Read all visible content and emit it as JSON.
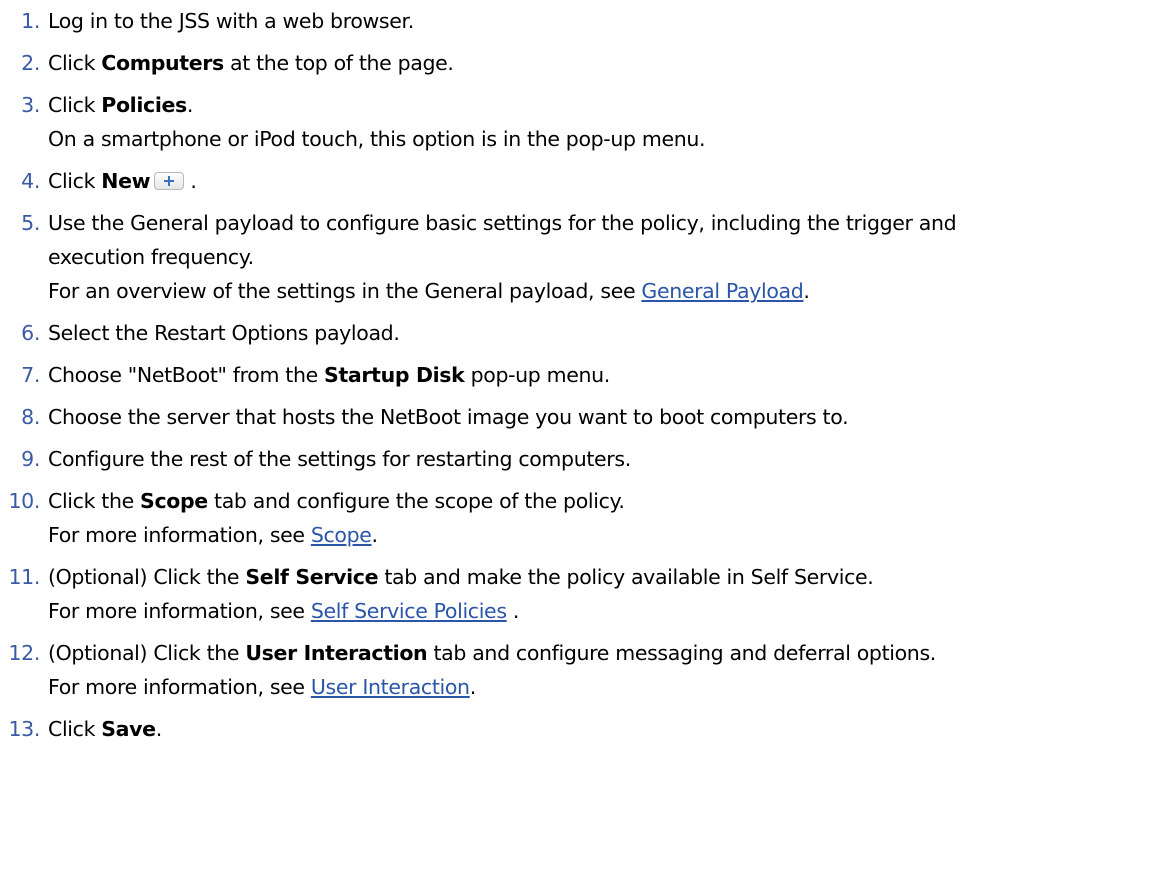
{
  "steps": [
    {
      "num": "1.",
      "a": "Log in to the JSS with a web browser."
    },
    {
      "num": "2.",
      "a": "Click ",
      "b": "Computers",
      "c": " at the top of the page."
    },
    {
      "num": "3.",
      "a": "Click ",
      "b": "Policies",
      "c": ".",
      "note": "On a smartphone or iPod touch, this option is in the pop-up menu."
    },
    {
      "num": "4.",
      "a": "Click ",
      "b": "New",
      "c": " ."
    },
    {
      "num": "5.",
      "a": "Use the General payload to configure basic settings for the policy, including the trigger and",
      "a2": "execution frequency.",
      "note": "For an overview of the settings in the General payload, see ",
      "link": "General Payload",
      "after": "."
    },
    {
      "num": "6.",
      "a": "Select the Restart Options payload."
    },
    {
      "num": "7.",
      "a": "Choose \"NetBoot\" from the ",
      "b": "Startup Disk",
      "c": " pop-up menu."
    },
    {
      "num": "8.",
      "a": "Choose the server that hosts the NetBoot image you want to boot computers to."
    },
    {
      "num": "9.",
      "a": "Configure the rest of the settings for restarting computers."
    },
    {
      "num": "10.",
      "a": "Click the ",
      "b": "Scope",
      "c": " tab and configure the scope of the policy.",
      "note": "For more information, see ",
      "link": "Scope",
      "after": "."
    },
    {
      "num": "11.",
      "a": "(Optional) Click the ",
      "b": "Self Service",
      "c": " tab and make the policy available in Self Service.",
      "note": "For more information, see ",
      "link": "Self Service Policies",
      "after": " ."
    },
    {
      "num": "12.",
      "a": "(Optional) Click the ",
      "b": "User Interaction",
      "c": " tab and configure messaging and deferral options.",
      "note": "For more information, see ",
      "link": "User Interaction",
      "after": "."
    },
    {
      "num": "13.",
      "a": "Click ",
      "b": "Save",
      "c": "."
    }
  ],
  "icons": {
    "new_button_icon": "plus-icon",
    "accent_color": "#3a5aa6",
    "link_color": "#2a55a8"
  }
}
